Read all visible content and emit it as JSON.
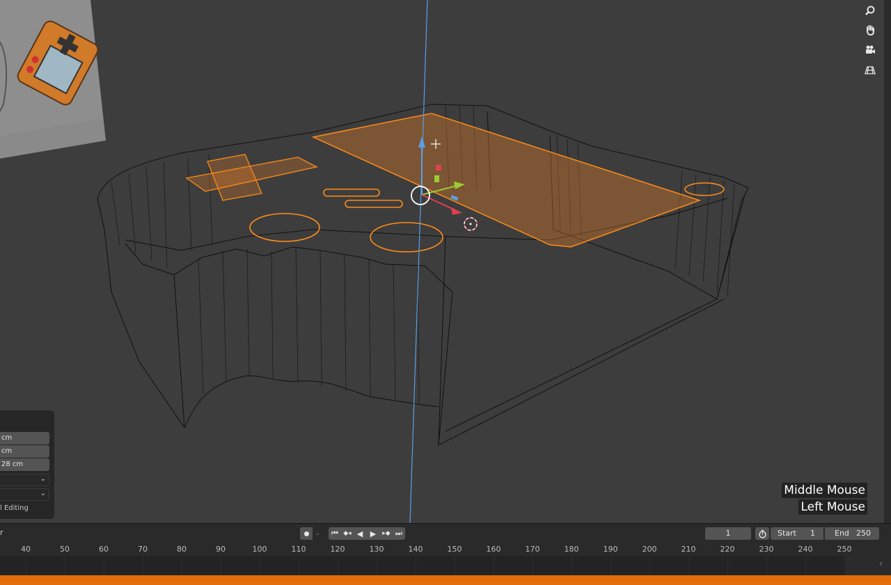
{
  "operator_panel": {
    "field_1": "cm",
    "field_2": "cm",
    "field_3": "28 cm",
    "label": "l Editing"
  },
  "navigation": {
    "zoom_icon": "magnifier-icon",
    "pan_icon": "hand-icon",
    "camera_icon": "camera-icon",
    "ortho_icon": "grid-icon"
  },
  "key_hints": [
    "Middle Mouse",
    "Left Mouse"
  ],
  "timeline": {
    "left_label": "r",
    "current_frame": "1",
    "start_label": "Start",
    "start_value": "1",
    "end_label": "End",
    "end_value": "250",
    "ruler": [
      "40",
      "50",
      "60",
      "70",
      "80",
      "90",
      "100",
      "110",
      "120",
      "130",
      "140",
      "150",
      "160",
      "170",
      "180",
      "190",
      "200",
      "210",
      "220",
      "230",
      "240",
      "250"
    ]
  },
  "colors": {
    "selection": "#ff8c1a",
    "z_axis": "#5b9ee6",
    "status_bar": "#e46c0a",
    "viewport_bg": "#3d3d3d"
  }
}
